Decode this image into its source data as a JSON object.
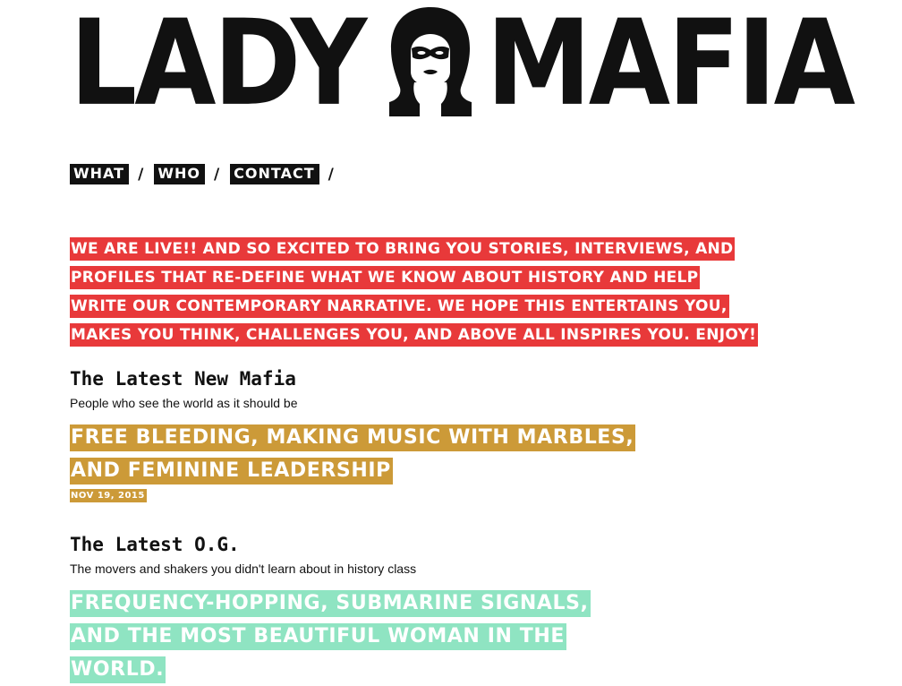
{
  "site": {
    "logo_left": "LADY",
    "logo_right": "MAFIA",
    "logo_icon": "hooded-woman-mask-icon"
  },
  "nav": {
    "items": [
      {
        "label": "WHAT"
      },
      {
        "label": "WHO"
      },
      {
        "label": "CONTACT"
      }
    ],
    "separator": "/"
  },
  "intro": {
    "text": "We are live!! And so excited to bring you stories, interviews, and profiles that re-define what we know about history and help write our contemporary narrative. We hope this entertains you, makes you think, challenges you, and above all inspires you. Enjoy!"
  },
  "latest_new_mafia": {
    "title": "The Latest New Mafia",
    "subtitle": "People who see the world as it should be",
    "story_title": "Free Bleeding, Making Music with Marbles, and Feminine Leadership",
    "date": "NOV 19, 2015"
  },
  "latest_og": {
    "title": "The Latest O.G.",
    "subtitle": "The movers and shakers you didn't learn about in history class",
    "story_title": "Frequency-Hopping, Submarine Signals, and the Most Beautiful Woman in the World."
  },
  "colors": {
    "intro_highlight": "#e8393a",
    "new_mafia_highlight": "#cc9a38",
    "og_highlight": "#8fe4c2",
    "nav_background": "#111111",
    "text": "#111111"
  }
}
